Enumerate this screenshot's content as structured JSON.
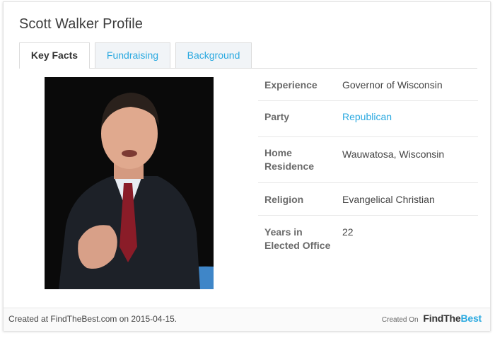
{
  "profile": {
    "title": "Scott Walker Profile",
    "tabs": [
      {
        "label": "Key Facts",
        "active": true
      },
      {
        "label": "Fundraising",
        "active": false
      },
      {
        "label": "Background",
        "active": false
      }
    ],
    "facts": [
      {
        "label": "Experience",
        "value": "Governor of Wisconsin"
      },
      {
        "label": "Party",
        "value": "Republican"
      },
      {
        "label": "Home Residence",
        "value": "Wauwatosa, Wisconsin"
      },
      {
        "label": "Religion",
        "value": "Evangelical Christian"
      },
      {
        "label": "Years in Elected Office",
        "value": "22"
      }
    ]
  },
  "footer": {
    "created_text": "Created at FindTheBest.com on 2015-04-15.",
    "created_on": "Created On",
    "brand_find": "FindThe",
    "brand_best": "Best"
  },
  "colors": {
    "accent": "#2aa9e0",
    "text": "#444444"
  }
}
